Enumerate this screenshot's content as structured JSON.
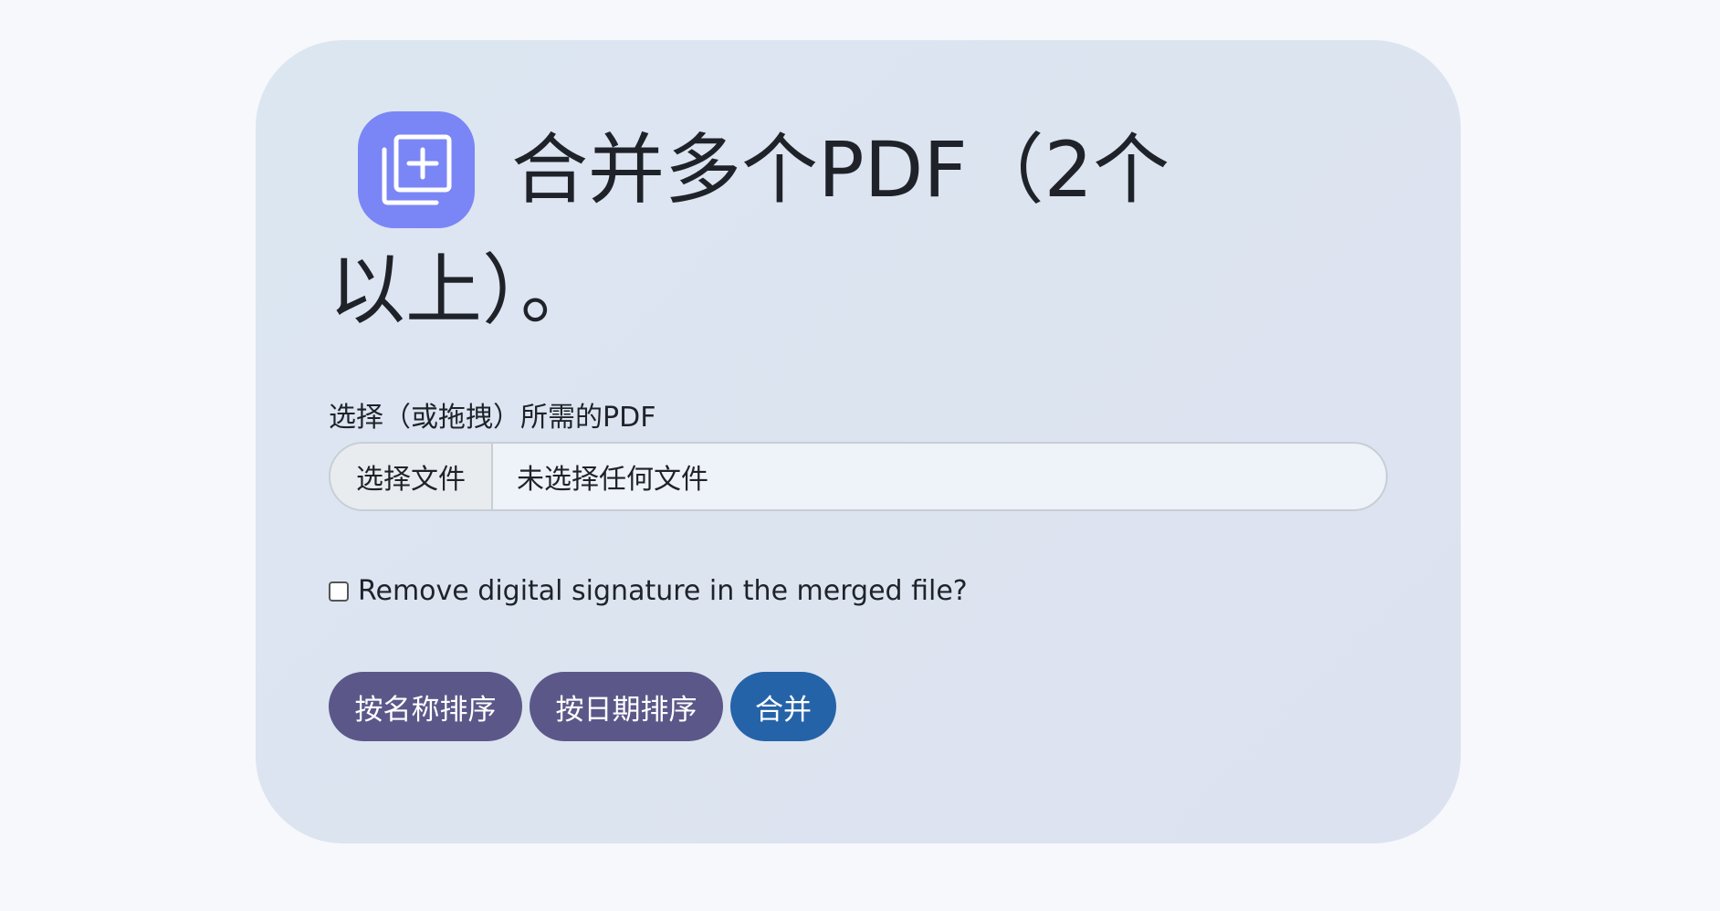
{
  "title": "合并多个PDF（2个以上）。",
  "title_icon": "add-to-stack-icon",
  "file_field": {
    "label": "选择（或拖拽）所需的PDF",
    "button_label": "选择文件",
    "status": "未选择任何文件"
  },
  "option": {
    "label": "Remove digital signature in the merged file?",
    "checked": false
  },
  "buttons": {
    "sort_by_name": "按名称排序",
    "sort_by_date": "按日期排序",
    "merge": "合并"
  },
  "colors": {
    "page_background": "#f6f8fc",
    "card_background": "#dce6f1",
    "icon_background": "#7a86f5",
    "secondary_button": "#5b5889",
    "primary_button": "#2563a8"
  }
}
